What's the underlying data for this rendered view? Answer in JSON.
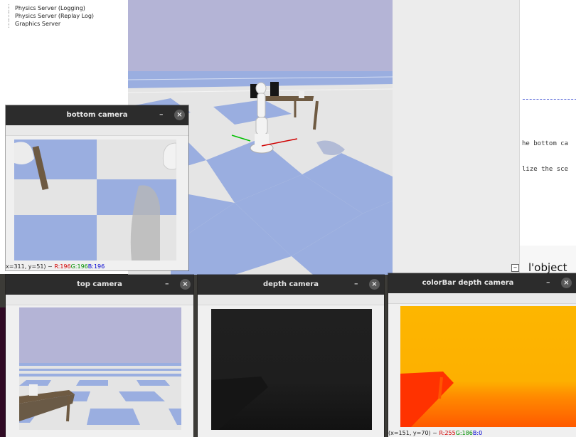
{
  "tree": {
    "items": [
      "Physics Server (Logging)",
      "Physics Server (Replay Log)",
      "Graphics Server"
    ]
  },
  "editor": {
    "code_lines": [
      "he bottom ca",
      "lize the sce"
    ],
    "bottom_text": "l'object"
  },
  "windows": {
    "bottom": {
      "title": "bottom camera",
      "status": {
        "coords": "x=311, y=51) ~ ",
        "r": "R:196",
        "g": "G:196",
        "b": "B:196"
      }
    },
    "top": {
      "title": "top camera"
    },
    "depth": {
      "title": "depth camera"
    },
    "colorbar": {
      "title": "colorBar depth camera",
      "status": {
        "coords": "(x=151, y=70) ~ ",
        "r": "R:255",
        "g": "G:186",
        "b": "B:0"
      }
    }
  },
  "icons": {
    "minimize": "–",
    "close": "×"
  },
  "colors": {
    "sky": "#b2b2d4",
    "tile_blue": "#9aaee0",
    "tile_light": "#e4e4e4",
    "depth_orange": "#fdb400",
    "depth_red": "#ff3300",
    "titlebar": "#2c2c2c"
  }
}
